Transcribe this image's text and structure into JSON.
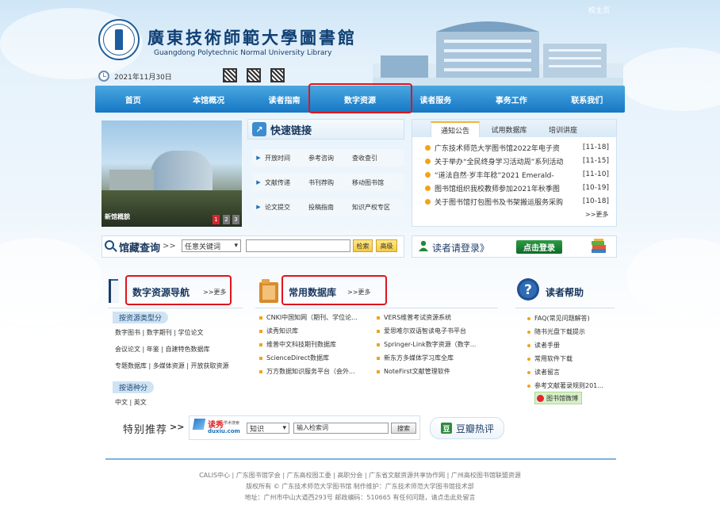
{
  "header": {
    "home_link": "校主页",
    "title": "廣東技術師範大學圖書館",
    "subtitle": "Guangdong Polytechnic Normal University Library",
    "date": "2021年11月30日"
  },
  "nav": [
    "首页",
    "本馆概况",
    "读者指南",
    "数字资源",
    "读者服务",
    "事务工作",
    "联系我们"
  ],
  "photo": {
    "caption": "新馆概貌",
    "pages": [
      "1",
      "2",
      "3"
    ]
  },
  "quick_links": {
    "title": "快速链接",
    "rows": [
      [
        "开放时间",
        "参考咨询",
        "查收查引"
      ],
      [
        "文献传递",
        "书刊荐购",
        "移动图书馆"
      ],
      [
        "论文提交",
        "投稿指南",
        "知识产权专区"
      ]
    ]
  },
  "notice_tabs": [
    "通知公告",
    "试用数据库",
    "培训讲座"
  ],
  "notices": [
    {
      "title": "广东技术师范大学图书馆2022年电子资",
      "date": "[11-18]"
    },
    {
      "title": "关于举办“全民终身学习活动周”系列活动",
      "date": "[11-15]"
    },
    {
      "title": "“道法自然·岁丰年稔”2021 Emerald-",
      "date": "[11-10]"
    },
    {
      "title": "图书馆组织我校教师参加2021年秋季图",
      "date": "[10-19]"
    },
    {
      "title": "关于图书馆打包图书及书架搬运服务采购",
      "date": "[10-18]"
    }
  ],
  "notices_more": ">>更多",
  "catalog": {
    "title": "馆藏查询",
    "arrows": ">>",
    "select": "任意关键词",
    "search_btn": "检索",
    "adv_btn": "高级"
  },
  "login": {
    "text": "读者请登录》",
    "button": "点击登录"
  },
  "digital_nav": {
    "title": "数字资源导航",
    "more": ">>更多",
    "type_label": "按资源类型分",
    "type_lines": [
      "数字图书 | 数字期刊 | 学位论文",
      "会议论文 | 年鉴 | 自建特色数据库",
      "专题数据库 | 多媒体资源 | 开放获取资源"
    ],
    "lang_label": "按语种分",
    "lang_line": "中文 | 英文"
  },
  "common_db": {
    "title": "常用数据库",
    "more": ">>更多",
    "left": [
      "CNKI中国知网（期刊、学位论...",
      "读秀知识库",
      "维普中文科技期刊数据库",
      "ScienceDirect数据库",
      "万方数据知识服务平台（会外..."
    ],
    "right": [
      "VERS维普考试资源系统",
      "爱思唯尔双语智读电子书平台",
      "Springer-Link数字资源（数字...",
      "新东方多媒体学习库全库",
      "NoteFirst文献管理软件"
    ]
  },
  "help": {
    "title": "读者帮助",
    "items": [
      "FAQ(常见问题解答)",
      "随书光盘下载提示",
      "读者手册",
      "常用软件下载",
      "读者留言",
      "参考文献著录规则201..."
    ],
    "weibo": "图书馆微博"
  },
  "recommend": {
    "title": "特别推荐",
    "arrows": ">>",
    "logo_main": "读秀",
    "logo_sub": "学术搜索",
    "logo_url": "duxiu.com",
    "select": "知识",
    "placeholder": "输入检索词",
    "search_btn": "搜索"
  },
  "douban": "豆瓣热评",
  "footer": {
    "links": "CALIS中心 | 广东图书馆学会 | 广东高校图工委 | 高职分会 | 广东省文献资源共享协作网 | 广州高校图书馆联盟资源",
    "copyright": "版权所有 © 广东技术师范大学图书馆 制作维护：广东技术师范大学图书馆技术部",
    "address": "地址：广州市中山大道西293号 邮政编码：510665  有任何问题，请点击此处留言"
  },
  "colors": {
    "nav_top": "#4aa7e0",
    "nav_bottom": "#1677c4",
    "highlight": "#e0141e",
    "accent_orange": "#f2a31a",
    "login_green": "#1f8a3a"
  }
}
